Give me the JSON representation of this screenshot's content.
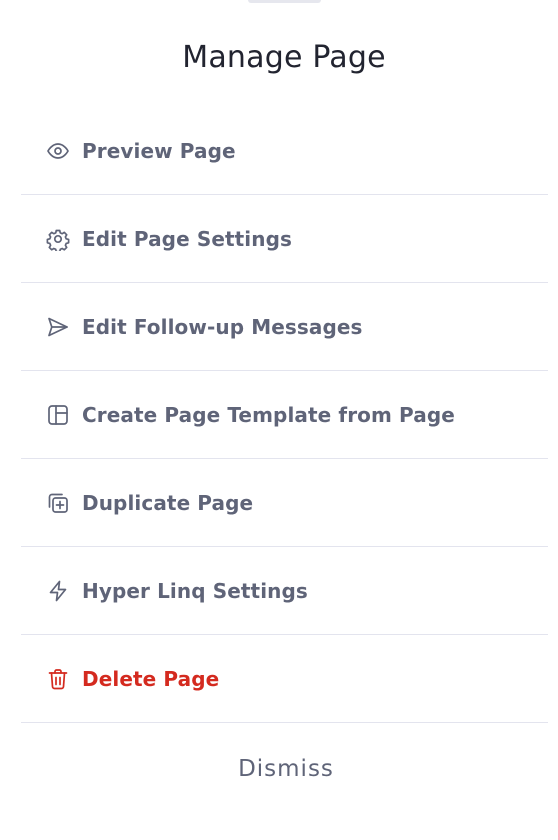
{
  "sheet": {
    "title": "Manage Page",
    "dismiss_label": "Dismiss"
  },
  "menu": {
    "items": [
      {
        "label": "Preview Page",
        "icon": "eye-icon"
      },
      {
        "label": "Edit Page Settings",
        "icon": "gear-icon"
      },
      {
        "label": "Edit Follow-up Messages",
        "icon": "send-icon"
      },
      {
        "label": "Create Page Template from Page",
        "icon": "template-icon"
      },
      {
        "label": "Duplicate Page",
        "icon": "duplicate-icon"
      },
      {
        "label": "Hyper Linq Settings",
        "icon": "lightning-icon"
      },
      {
        "label": "Delete Page",
        "icon": "trash-icon"
      }
    ]
  },
  "colors": {
    "text": "#5f6478",
    "title": "#222430",
    "danger": "#d42a1f",
    "divider": "#e3e4ee"
  }
}
